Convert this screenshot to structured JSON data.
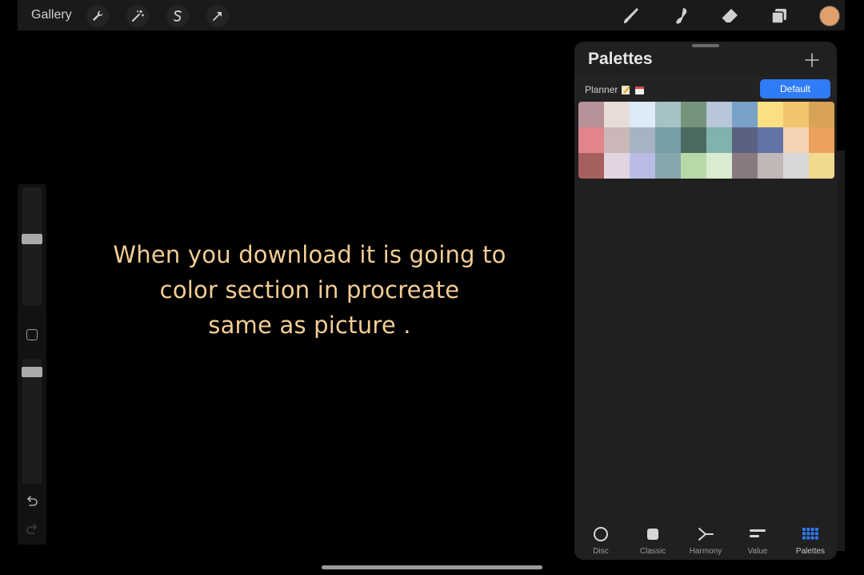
{
  "toolbar": {
    "gallery_label": "Gallery",
    "left_tools": [
      "wrench-icon",
      "magic-wand-icon",
      "selection-icon",
      "transform-arrow-icon"
    ],
    "right_tools": [
      "brush-icon",
      "smudge-icon",
      "eraser-icon",
      "layers-icon"
    ],
    "current_color": "#e0a06c"
  },
  "canvas": {
    "lines": [
      "When you download it is going to",
      "color section in procreate",
      "same as picture ."
    ],
    "text_color": "#f3cd95"
  },
  "sidebar": {
    "brush_size_level": 0.55,
    "opacity_level": 0.9
  },
  "palettes_panel": {
    "title": "Palettes",
    "palette_name": "Planner",
    "palette_name_icons": [
      "pencil-note-emoji",
      "calendar-emoji"
    ],
    "default_label": "Default",
    "swatches": [
      "#b79198",
      "#e8dcd9",
      "#dcebf6",
      "#a5c2c6",
      "#76937b",
      "#b7c6d9",
      "#7aa1c8",
      "#fbdf82",
      "#f1c46f",
      "#d8a358",
      "#e2848c",
      "#cbb7b8",
      "#a6b3c2",
      "#76a0a6",
      "#4b6a61",
      "#80b3ad",
      "#5b6180",
      "#6473a6",
      "#f6d3b2",
      "#eba25d",
      "#a5605e",
      "#e3d4e2",
      "#b9bce5",
      "#88a6ad",
      "#b9d8a8",
      "#d9ebd0",
      "#897a7f",
      "#c0b8b7",
      "#d8d8d8",
      "#f2da8d"
    ],
    "tabs": [
      {
        "label": "Disc",
        "icon": "disc-icon"
      },
      {
        "label": "Classic",
        "icon": "classic-square-icon"
      },
      {
        "label": "Harmony",
        "icon": "harmony-icon"
      },
      {
        "label": "Value",
        "icon": "value-bars-icon"
      },
      {
        "label": "Palettes",
        "icon": "palettes-grid-icon"
      }
    ],
    "active_tab": "Palettes",
    "accent_color": "#2f7cf6"
  }
}
